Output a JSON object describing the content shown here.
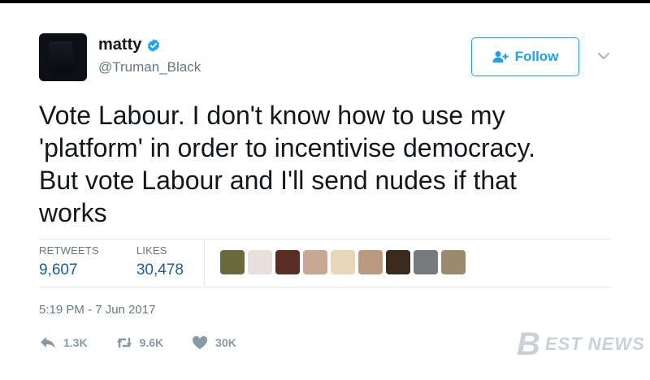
{
  "user": {
    "display_name": "matty",
    "handle": "@Truman_Black",
    "verified": true,
    "avatar_color": "#0d0f17"
  },
  "follow_button": {
    "label": "Follow",
    "icon": "add-user-icon",
    "color": "#1da1f2"
  },
  "tweet": {
    "lines": [
      "Vote Labour. I don't know how to use my",
      "'platform' in order to incentivise democracy.",
      "But vote Labour and I'll send nudes if that",
      "works"
    ]
  },
  "stats": {
    "retweets_label": "RETWEETS",
    "retweets_value": "9,607",
    "likes_label": "LIKES",
    "likes_value": "30,478"
  },
  "likers": [
    "#6b6a3f",
    "#e9e0dc",
    "#5a2d24",
    "#c9a892",
    "#e8d6b8",
    "#b99a7f",
    "#3a2a1e",
    "#777a7c",
    "#9a8b6c"
  ],
  "timestamp": "5:19 PM - 7 Jun 2017",
  "actions": {
    "reply": {
      "icon": "reply-icon",
      "count": "1.3K"
    },
    "retweet": {
      "icon": "retweet-icon",
      "count": "9.6K"
    },
    "like": {
      "icon": "heart-icon",
      "count": "30K"
    }
  },
  "watermark": {
    "logo": "B",
    "text": "EST NEWS"
  }
}
